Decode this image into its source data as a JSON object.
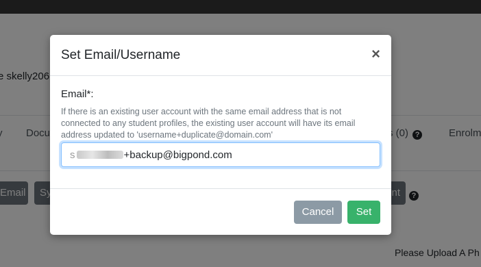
{
  "background": {
    "name_fragment": "e skelly206",
    "tabs": [
      "y",
      "Docu",
      "s (0)",
      "Enrolme"
    ],
    "buttons": [
      "Email",
      "Sy",
      "nt"
    ],
    "help_symbol": "?",
    "upload_label": "Please Upload A Ph"
  },
  "modal": {
    "title": "Set Email/Username",
    "close_symbol": "×",
    "email_label": "Email*:",
    "help_text": "If there is an existing user account with the same email address that is not connected to any student profiles, the existing user account will have its email address updated to 'username+duplicate@domain.com'",
    "email_value_first_char": "s",
    "email_value_visible": "+backup@bigpond.com",
    "cancel_label": "Cancel",
    "set_label": "Set"
  },
  "colors": {
    "set_button": "#38b26b",
    "cancel_button": "#8c9aa5",
    "input_focus": "#80bdff"
  }
}
